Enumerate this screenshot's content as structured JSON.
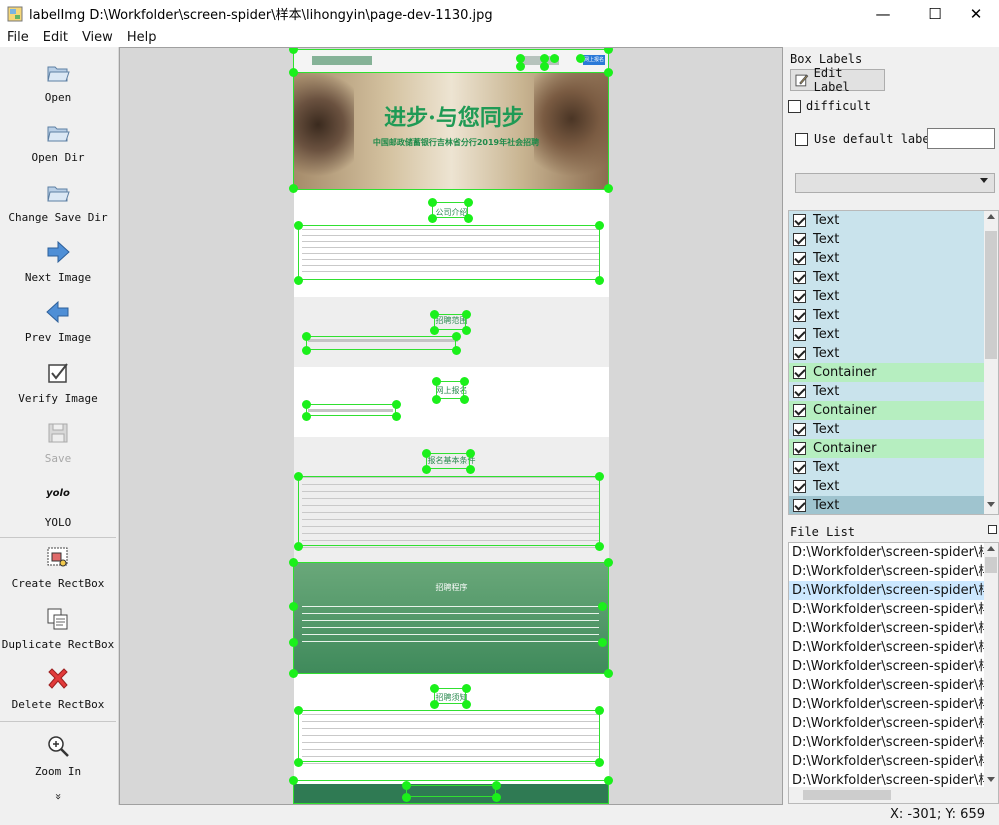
{
  "window": {
    "title": "labelImg D:\\Workfolder\\screen-spider\\样本\\lihongyin\\page-dev-1130.jpg",
    "minimize": "—",
    "maximize": "☐",
    "close": "✕"
  },
  "menu": [
    "File",
    "Edit",
    "View",
    "Help"
  ],
  "tools": {
    "open": "Open",
    "open_dir": "Open Dir",
    "change_save_dir": "Change Save Dir",
    "next_image": "Next Image",
    "prev_image": "Prev Image",
    "verify_image": "Verify Image",
    "save": "Save",
    "yolo_icon": "yolo",
    "yolo": "YOLO",
    "create_rectbox": "Create RectBox",
    "duplicate_rectbox": "Duplicate RectBox",
    "delete_rectbox": "Delete RectBox",
    "zoom_in": "Zoom In",
    "more": "»"
  },
  "box_labels": {
    "title": "Box Labels",
    "edit_label": "Edit Label",
    "difficult": "difficult",
    "use_default_label": "Use default label",
    "default_label_value": "",
    "combo_value": "",
    "items": [
      {
        "label": "Text",
        "color": "#c9e3ec"
      },
      {
        "label": "Text",
        "color": "#c9e3ec"
      },
      {
        "label": "Text",
        "color": "#c9e3ec"
      },
      {
        "label": "Text",
        "color": "#c9e3ec"
      },
      {
        "label": "Text",
        "color": "#c9e3ec"
      },
      {
        "label": "Text",
        "color": "#c9e3ec"
      },
      {
        "label": "Text",
        "color": "#c9e3ec"
      },
      {
        "label": "Text",
        "color": "#c9e3ec"
      },
      {
        "label": "Container",
        "color": "#b6eec0"
      },
      {
        "label": "Text",
        "color": "#c9e3ec"
      },
      {
        "label": "Container",
        "color": "#b6eec0"
      },
      {
        "label": "Text",
        "color": "#c9e3ec"
      },
      {
        "label": "Container",
        "color": "#b6eec0"
      },
      {
        "label": "Text",
        "color": "#c9e3ec"
      },
      {
        "label": "Text",
        "color": "#c9e3ec"
      },
      {
        "label": "Text",
        "color": "#9fc4cf"
      }
    ]
  },
  "file_list": {
    "title": "File List",
    "items": [
      "D:\\Workfolder\\screen-spider\\样本",
      "D:\\Workfolder\\screen-spider\\样本",
      "D:\\Workfolder\\screen-spider\\样本",
      "D:\\Workfolder\\screen-spider\\样本",
      "D:\\Workfolder\\screen-spider\\样本",
      "D:\\Workfolder\\screen-spider\\样本",
      "D:\\Workfolder\\screen-spider\\样本",
      "D:\\Workfolder\\screen-spider\\样本",
      "D:\\Workfolder\\screen-spider\\样本",
      "D:\\Workfolder\\screen-spider\\样本",
      "D:\\Workfolder\\screen-spider\\样本",
      "D:\\Workfolder\\screen-spider\\样本",
      "D:\\Workfolder\\screen-spider\\样本"
    ],
    "selected_index": 2
  },
  "canvas_image": {
    "banner_title": "进步·与您同步",
    "banner_subtitle": "中国邮政储蓄银行吉林省分行2019年社会招聘",
    "sections": [
      "公司介绍",
      "招聘范围",
      "网上报名",
      "报名基本条件",
      "招聘程序",
      "招聘须知"
    ],
    "nav_button": "网上报名"
  },
  "status": {
    "coords": "X: -301; Y: 659"
  },
  "colors": {
    "accent_green": "#1bf01b",
    "label_text_bg": "#c9e3ec",
    "label_container_bg": "#b6eec0",
    "selected_row": "#cce8ff"
  }
}
